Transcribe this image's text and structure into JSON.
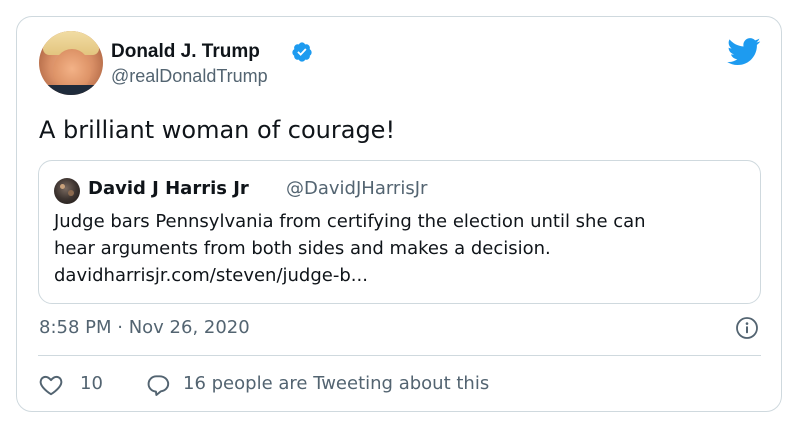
{
  "author": {
    "name": "Donald J. Trump",
    "handle": "@realDonaldTrump",
    "verified": true
  },
  "tweet": {
    "text": "A brilliant woman of courage!",
    "timestamp": "8:58 PM · Nov 26, 2020"
  },
  "quoted_tweet": {
    "author_name": "David J Harris Jr",
    "author_handle": "@DavidJHarrisJr",
    "lines": [
      "Judge bars Pennsylvania from certifying the election until she can",
      "hear arguments from both sides and makes a decision.",
      "davidharrisjr.com/steven/judge-b..."
    ]
  },
  "engagement": {
    "likes": "10",
    "tweeting": "16 people are Tweeting about this"
  },
  "icons": {
    "brand": "twitter-bird-icon",
    "verified": "verified-badge-icon",
    "info": "info-icon",
    "like": "heart-icon",
    "reply": "reply-bubble-icon"
  },
  "colors": {
    "twitter_blue": "#1d9bf0",
    "text_primary": "#0f1419",
    "text_secondary": "#536471",
    "border": "#cfd9de"
  }
}
